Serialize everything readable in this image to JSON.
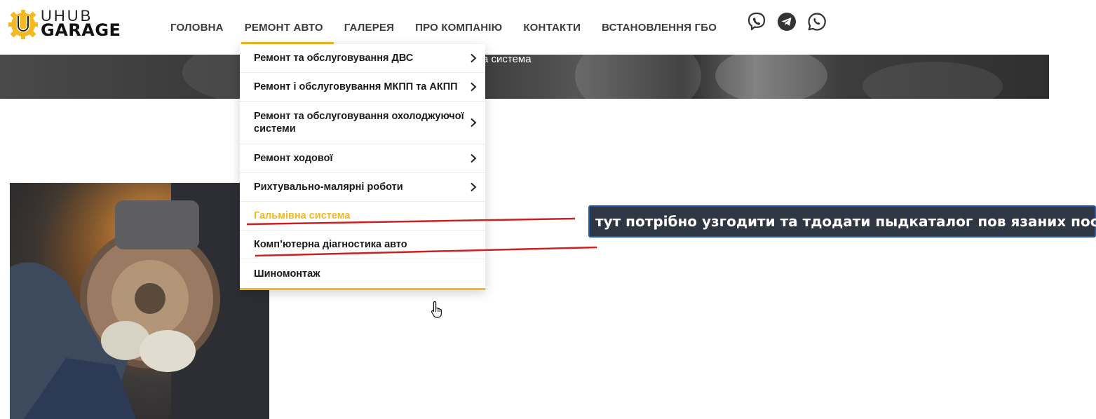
{
  "logo": {
    "top_text": "UHUB",
    "bottom_text": "GARAGE",
    "accent": "#f4b820"
  },
  "nav": {
    "items": [
      {
        "label": "ГОЛОВНА"
      },
      {
        "label": "РЕМОНТ АВТО",
        "active": true
      },
      {
        "label": "ГАЛЕРЕЯ"
      },
      {
        "label": "ПРО КОМПАНІЮ"
      },
      {
        "label": "КОНТАКТИ"
      },
      {
        "label": "ВСТАНОВЛЕННЯ ГБО"
      }
    ]
  },
  "socials": [
    {
      "icon": "viber-icon"
    },
    {
      "icon": "telegram-icon"
    },
    {
      "icon": "whatsapp-icon"
    }
  ],
  "banner": {
    "breadcrumb_tail": "а система"
  },
  "dropdown": {
    "items": [
      {
        "label": "Ремонт та обслуговування ДВС",
        "has_submenu": true
      },
      {
        "label": "Ремонт і обслуговування МКПП та АКПП",
        "has_submenu": true
      },
      {
        "label": "Ремонт та обслуговування охолоджуючої системи",
        "has_submenu": true
      },
      {
        "label": "Ремонт ходової",
        "has_submenu": true
      },
      {
        "label": "Рихтувально-малярні роботи",
        "has_submenu": true
      },
      {
        "label": "Гальмівна система",
        "has_submenu": false,
        "current": true
      },
      {
        "label": "Комп’ютерна діагностика авто",
        "has_submenu": false
      },
      {
        "label": "Шиномонтаж",
        "has_submenu": false
      }
    ]
  },
  "annotation": {
    "note": "тут потрібно узгодити та тдодати пыдкаталог пов язаних послуг",
    "line_color": "#cc1f1f"
  },
  "colors": {
    "accent": "#f4b820",
    "text": "#3c3c3c"
  }
}
